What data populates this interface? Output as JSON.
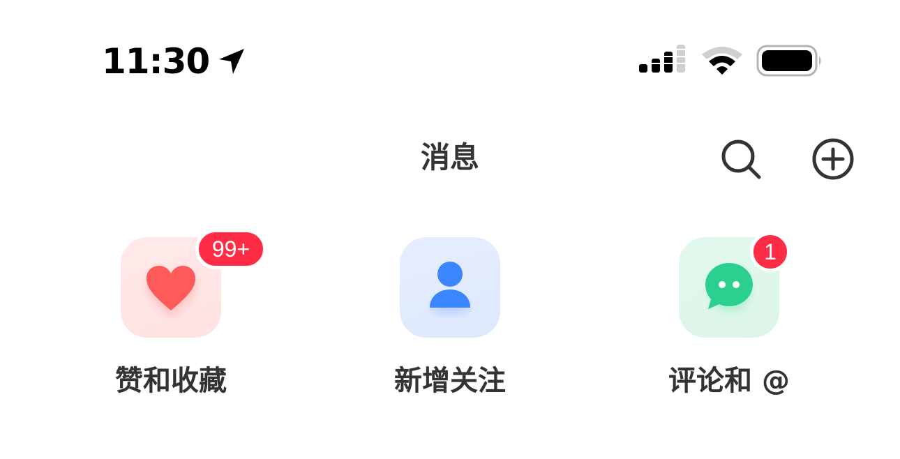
{
  "status_bar": {
    "time": "11:30",
    "icons": [
      "location-arrow-icon",
      "cellular-signal-icon",
      "wifi-icon",
      "battery-icon"
    ]
  },
  "nav": {
    "title": "消息",
    "actions": [
      "search-icon",
      "plus-circle-icon"
    ]
  },
  "tiles": [
    {
      "label": "赞和收藏",
      "icon": "heart-icon",
      "badge": "99+",
      "icon_color": "#ff5a5a",
      "bg_color": "#ffe6e6"
    },
    {
      "label": "新增关注",
      "icon": "person-icon",
      "badge": "",
      "icon_color": "#3b86ff",
      "bg_color": "#e2ecff"
    },
    {
      "label": "评论和 @",
      "icon": "chat-bubble-icon",
      "badge": "1",
      "icon_color": "#2bd08e",
      "bg_color": "#e0f7eb"
    }
  ],
  "colors": {
    "badge": "#fe2c45",
    "text": "#333333"
  }
}
